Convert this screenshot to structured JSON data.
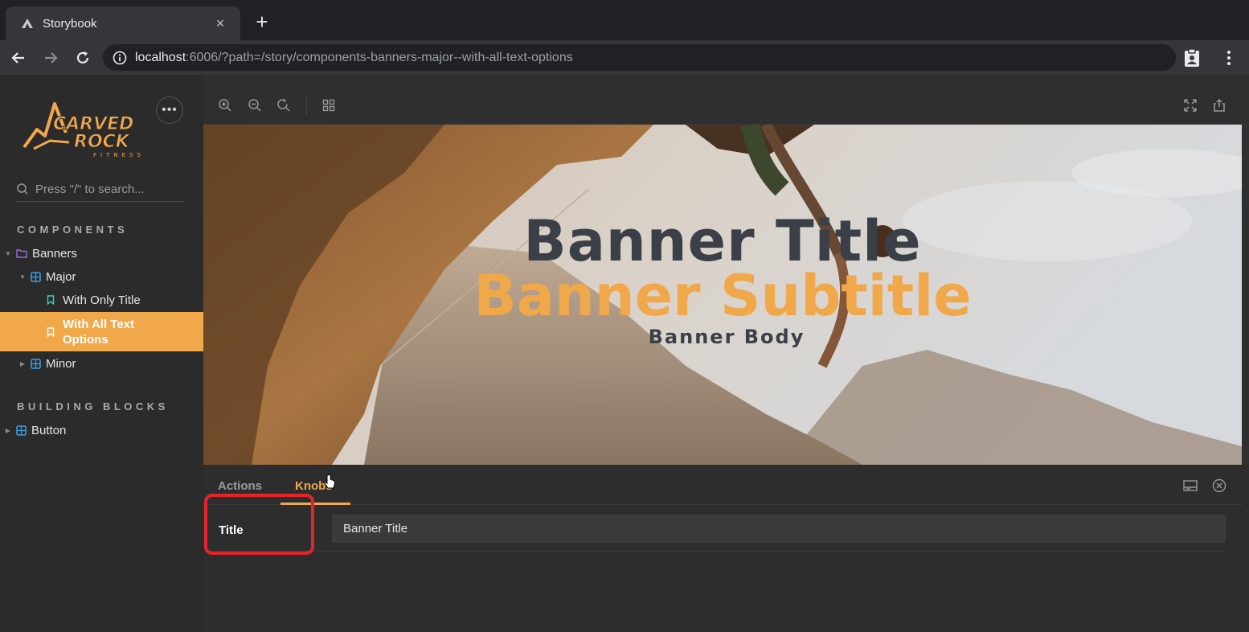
{
  "browser": {
    "tab_title": "Storybook",
    "tab_close": "×",
    "new_tab": "+",
    "url_host": "localhost",
    "url_rest": ":6006/?path=/story/components-banners-major--with-all-text-options"
  },
  "sidebar": {
    "menu_label": "•••",
    "search_placeholder": "Press \"/\" to search...",
    "sections": [
      {
        "title": "COMPONENTS"
      },
      {
        "title": "BUILDING BLOCKS"
      }
    ],
    "items": [
      {
        "label": "Banners"
      },
      {
        "label": "Major"
      },
      {
        "label": "With Only Title"
      },
      {
        "label": "With All Text Options",
        "selected": true
      },
      {
        "label": "Minor"
      },
      {
        "label": "Button"
      }
    ],
    "logo_text": [
      "CARVED",
      "ROCK",
      "FITNESS"
    ]
  },
  "banner": {
    "title": "Banner Title",
    "subtitle": "Banner Subtitle",
    "body": "Banner Body"
  },
  "addons": {
    "tabs": [
      {
        "label": "Actions"
      },
      {
        "label": "Knobs"
      }
    ],
    "knobs": [
      {
        "label": "Title",
        "value": "Banner Title"
      }
    ]
  },
  "colors": {
    "accent": "#f0a84b",
    "title_color": "#3b3f47",
    "highlight": "#e3252b"
  }
}
